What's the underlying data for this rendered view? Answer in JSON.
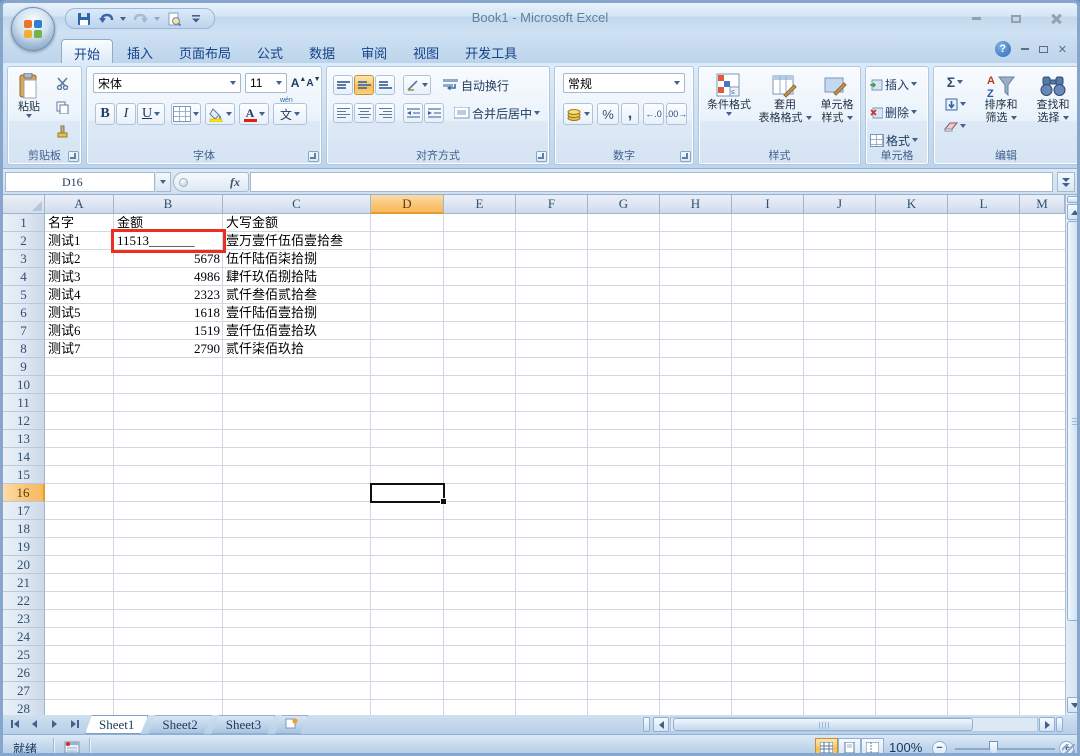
{
  "window": {
    "title": "Book1 - Microsoft Excel"
  },
  "tabs": [
    "开始",
    "插入",
    "页面布局",
    "公式",
    "数据",
    "审阅",
    "视图",
    "开发工具"
  ],
  "ribbon": {
    "clipboard": {
      "label": "剪贴板",
      "paste": "粘贴"
    },
    "font": {
      "label": "字体",
      "name": "宋体",
      "size": "11",
      "bold": "B",
      "italic": "I",
      "underline": "U",
      "phonetic": "文",
      "phonetic_hint": "wén"
    },
    "alignment": {
      "label": "对齐方式",
      "wrap": "自动换行",
      "merge": "合并后居中"
    },
    "number": {
      "label": "数字",
      "format": "常规",
      "percent": "%",
      "comma": ",",
      "inc_decimal": ".0",
      "dec_decimal": ".00"
    },
    "styles": {
      "label": "样式",
      "conditional": "条件格式",
      "table1": "套用",
      "table2": "表格格式",
      "cell1": "单元格",
      "cell2": "样式"
    },
    "cells": {
      "label": "单元格",
      "insert": "插入",
      "del": "删除",
      "format": "格式"
    },
    "editing": {
      "label": "编辑",
      "sigma": "Σ",
      "sort1": "排序和",
      "sort2": "筛选",
      "find1": "查找和",
      "find2": "选择"
    }
  },
  "formula_bar": {
    "name_box": "D16",
    "fx": "fx",
    "value": ""
  },
  "sheet": {
    "columns": [
      "A",
      "B",
      "C",
      "D",
      "E",
      "F",
      "G",
      "H",
      "I",
      "J",
      "K",
      "L",
      "M"
    ],
    "selected_column": "D",
    "selected_row": 16,
    "selected_cell": "D16",
    "row_count": 28,
    "rows": [
      {
        "r": 1,
        "A": "名字",
        "B": "金额",
        "C": "大写金额",
        "b_left": true
      },
      {
        "r": 2,
        "A": "测试1",
        "B": "11513_______",
        "C": "壹万壹仟伍佰壹拾叁",
        "b_left": true,
        "red": true
      },
      {
        "r": 3,
        "A": "测试2",
        "B": "5678",
        "C": "伍仟陆佰柒拾捌"
      },
      {
        "r": 4,
        "A": "测试3",
        "B": "4986",
        "C": "肆仟玖佰捌拾陆"
      },
      {
        "r": 5,
        "A": "测试4",
        "B": "2323",
        "C": "贰仟叁佰贰拾叁"
      },
      {
        "r": 6,
        "A": "测试5",
        "B": "1618",
        "C": "壹仟陆佰壹拾捌"
      },
      {
        "r": 7,
        "A": "测试6",
        "B": "1519",
        "C": "壹仟伍佰壹拾玖"
      },
      {
        "r": 8,
        "A": "测试7",
        "B": "2790",
        "C": "贰仟柒佰玖拾"
      }
    ]
  },
  "sheet_tabs": [
    "Sheet1",
    "Sheet2",
    "Sheet3"
  ],
  "status": {
    "ready": "就绪",
    "zoom": "100%"
  },
  "colors": {
    "selection_orange": "#f9c677",
    "red_highlight_border": "#ec2d1f",
    "grid_line": "#d0d7e5",
    "ribbon_blue": "#c7dcf1",
    "active_button_orange": "#fcc863"
  }
}
